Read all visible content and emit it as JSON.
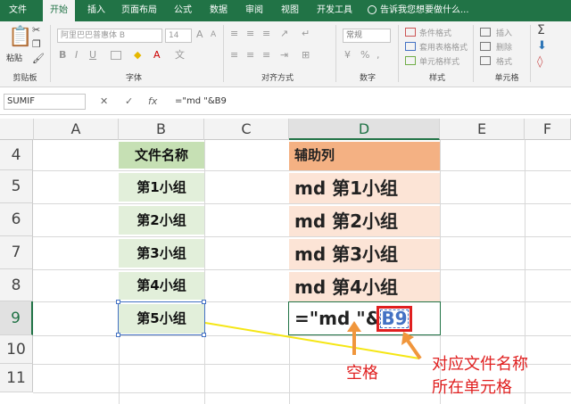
{
  "ribbon": {
    "tabs": [
      "文件",
      "开始",
      "插入",
      "页面布局",
      "公式",
      "数据",
      "审阅",
      "视图",
      "开发工具"
    ],
    "active_tab": "开始",
    "tell_me": "告诉我您想要做什么...",
    "clipboard": {
      "paste": "粘贴",
      "group": "剪贴板"
    },
    "font": {
      "name": "阿里巴巴普惠体 B",
      "size": "14",
      "group": "字体"
    },
    "alignment": {
      "group": "对齐方式"
    },
    "number": {
      "format": "常规",
      "group": "数字"
    },
    "styles": {
      "conditional": "条件格式",
      "table": "套用表格格式",
      "cell": "单元格样式",
      "group": "样式"
    },
    "cells": {
      "insert": "插入",
      "delete": "删除",
      "format": "格式",
      "group": "单元格"
    }
  },
  "formula_bar": {
    "name_box": "SUMIF",
    "cancel": "✕",
    "enter": "✓",
    "fx": "fx",
    "formula": "=\"md \"&B9"
  },
  "columns": [
    "A",
    "B",
    "C",
    "D",
    "E",
    "F"
  ],
  "rows": [
    "4",
    "5",
    "6",
    "7",
    "8",
    "9",
    "10",
    "11"
  ],
  "cells": {
    "B4": "文件名称",
    "B5": "第1小组",
    "B6": "第2小组",
    "B7": "第3小组",
    "B8": "第4小组",
    "B9": "第5小组",
    "D4": "辅助列",
    "D5": "md 第1小组",
    "D6": "md 第2小组",
    "D7": "md 第3小组",
    "D8": "md 第4小组",
    "D9_prefix": "=\"md \"&",
    "D9_ref": "B9"
  },
  "annotations": {
    "space": "空格",
    "ref_line1": "对应文件名称",
    "ref_line2": "所在单元格"
  },
  "colors": {
    "excel_green": "#217346",
    "annotation_red": "#e02020",
    "ref_blue": "#4472c4",
    "arrow_orange": "#f0963c",
    "line_yellow": "#f5e614"
  }
}
